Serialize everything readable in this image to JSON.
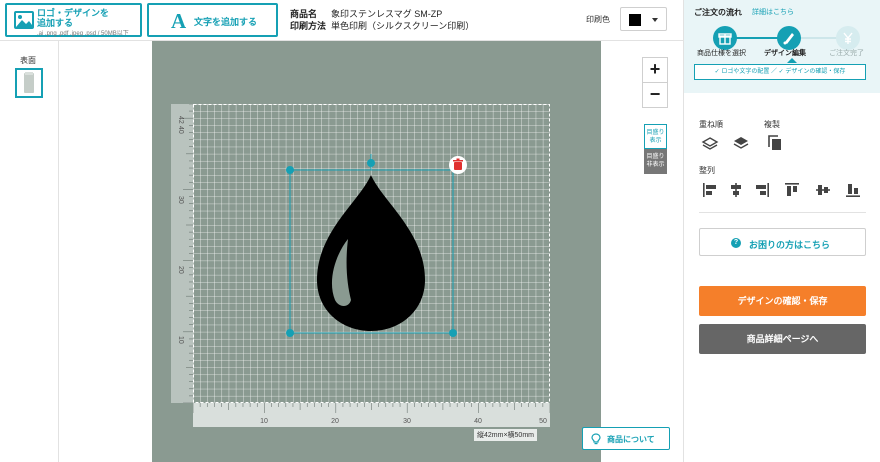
{
  "toolbar": {
    "upload_label_line1": "ロゴ・デザインを",
    "upload_label_line2": "追加する",
    "upload_formats": ".ai .png .pdf .jpeg .psd / 50MB以下",
    "add_text_label": "文字を追加する",
    "add_text_icon": "A"
  },
  "product": {
    "name_key": "商品名",
    "name_value": "象印ステンレスマグ SM-ZP",
    "method_key": "印刷方法",
    "method_value": "単色印刷（シルクスクリーン印刷）"
  },
  "print_color": {
    "label": "印刷色",
    "value": "#000000"
  },
  "sides": {
    "front_label": "表面"
  },
  "canvas": {
    "zoom_in": "+",
    "zoom_out": "−",
    "grid_show": "目盛り表示",
    "grid_hide": "目盛り非表示",
    "size_label": "縦42mm×横50mm",
    "ruler_v_ticks": [
      "10",
      "20",
      "30",
      "40",
      "42"
    ],
    "ruler_h_ticks": [
      "10",
      "20",
      "30",
      "40",
      "50"
    ],
    "product_about": "商品について",
    "design_icon": "water-drop-icon",
    "bottle_color": "#8a9a91",
    "accent_color": "#15a0b4"
  },
  "flow": {
    "title": "ご注文の流れ",
    "detail_link": "詳細はこちら",
    "steps": [
      {
        "label": "商品仕様を選択",
        "icon": "gift-icon"
      },
      {
        "label": "デザイン編集",
        "icon": "brush-icon"
      },
      {
        "label": "ご注文完了",
        "icon": "yen-icon"
      }
    ],
    "substeps": "✓ ロゴや文字の配置 ／ ✓ デザインの確認・保存"
  },
  "tools": {
    "layer_label": "重ね順",
    "duplicate_label": "複製",
    "align_label": "整列"
  },
  "help_label": "お困りの方はこちら",
  "save_label": "デザインの確認・保存",
  "detail_label": "商品詳細ページへ"
}
